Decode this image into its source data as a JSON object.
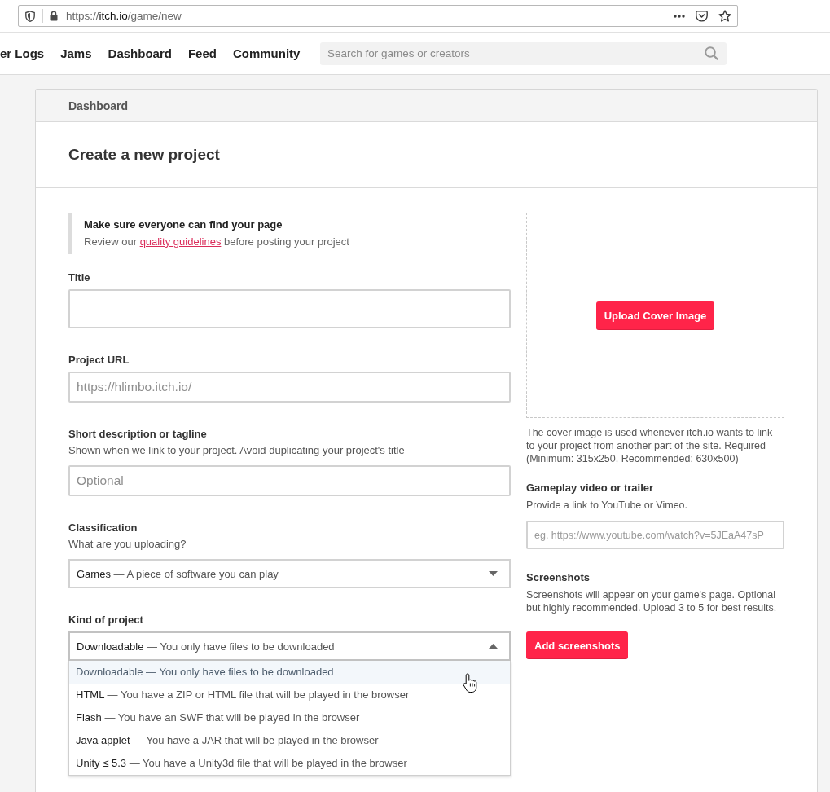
{
  "browser": {
    "url": {
      "scheme": "https://",
      "host": "itch.io",
      "path": "/game/new"
    }
  },
  "nav": {
    "links": [
      "er Logs",
      "Jams",
      "Dashboard",
      "Feed",
      "Community"
    ],
    "search": {
      "placeholder": "Search for games or creators"
    }
  },
  "card": {
    "breadcrumb": "Dashboard",
    "heading": "Create a new project"
  },
  "notice": {
    "title": "Make sure everyone can find your page",
    "text_before": "Review our",
    "link": "quality guidelines",
    "text_after": "before posting your project"
  },
  "fields": [
    {
      "kind": "large-input",
      "label": "Title"
    },
    {
      "kind": "input",
      "label": "Project URL",
      "placeholder": "https://hlimbo.itch.io/"
    },
    {
      "kind": "input",
      "label": "Short description or tagline",
      "hint": "Shown when we link to your project. Avoid duplicating your project's title",
      "placeholder": "Optional"
    },
    {
      "kind": "select",
      "label": "Classification",
      "hint": "What are you uploading?",
      "value": {
        "name": "Games",
        "description": "— A piece of software you can play"
      },
      "expanded": false
    },
    {
      "kind": "select",
      "label": "Kind of project",
      "value": {
        "name": "Downloadable",
        "description": "— You only have files to be downloaded"
      },
      "expanded": true,
      "options": [
        {
          "name": "Downloadable",
          "description": "— You only have files to be downloaded",
          "selected": true
        },
        {
          "name": "HTML",
          "description": "— You have a ZIP or HTML file that will be played in the browser",
          "selected": false
        },
        {
          "name": "Flash",
          "description": "— You have an SWF that will be played in the browser",
          "selected": false
        },
        {
          "name": "Java applet",
          "description": "— You have a JAR that will be played in the browser",
          "selected": false
        },
        {
          "name": "Unity ≤ 5.3",
          "description": "— You have a Unity3d file that will be played in the browser",
          "selected": false
        }
      ]
    }
  ],
  "cover": {
    "button": "Upload Cover Image",
    "caption": "The cover image is used whenever itch.io wants to link to your project from another part of the site. Required (Minimum: 315x250, Recommended: 630x500)"
  },
  "video": {
    "label": "Gameplay video or trailer",
    "hint": "Provide a link to YouTube or Vimeo.",
    "placeholder": "eg. https://www.youtube.com/watch?v=5JEaA47sP"
  },
  "screenshots": {
    "label": "Screenshots",
    "hint": "Screenshots will appear on your game's page. Optional but highly recommended. Upload 3 to 5 for best results.",
    "button": "Add screenshots"
  }
}
